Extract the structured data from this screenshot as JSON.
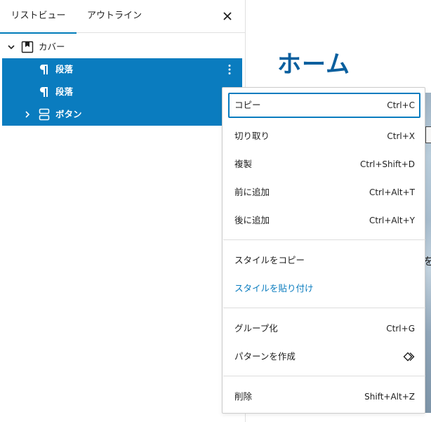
{
  "tabs": {
    "list_view": "リストビュー",
    "outline": "アウトライン"
  },
  "tree": {
    "cover_label": "カバー",
    "paragraph1_label": "段落",
    "paragraph2_label": "段落",
    "buttons_label": "ボタン"
  },
  "canvas": {
    "page_title": "ホーム",
    "cover_text_fragment": "を"
  },
  "menu": {
    "items": [
      {
        "label": "コピー",
        "shortcut": "Ctrl+C"
      },
      {
        "label": "切り取り",
        "shortcut": "Ctrl+X"
      },
      {
        "label": "複製",
        "shortcut": "Ctrl+Shift+D"
      },
      {
        "label": "前に追加",
        "shortcut": "Ctrl+Alt+T"
      },
      {
        "label": "後に追加",
        "shortcut": "Ctrl+Alt+Y"
      },
      {
        "label": "スタイルをコピー",
        "shortcut": ""
      },
      {
        "label": "スタイルを貼り付け",
        "shortcut": ""
      },
      {
        "label": "グループ化",
        "shortcut": "Ctrl+G"
      },
      {
        "label": "パターンを作成",
        "shortcut": ""
      },
      {
        "label": "削除",
        "shortcut": "Shift+Alt+Z"
      }
    ]
  },
  "colors": {
    "accent": "#0a7cbf",
    "selection": "#0a7cbf",
    "title": "#0a5f9e"
  },
  "icons": {
    "close": "close-icon",
    "cover": "cover-block-icon",
    "paragraph": "paragraph-icon",
    "buttons": "buttons-block-icon",
    "options": "more-vertical-icon",
    "pattern": "symbol-icon"
  }
}
